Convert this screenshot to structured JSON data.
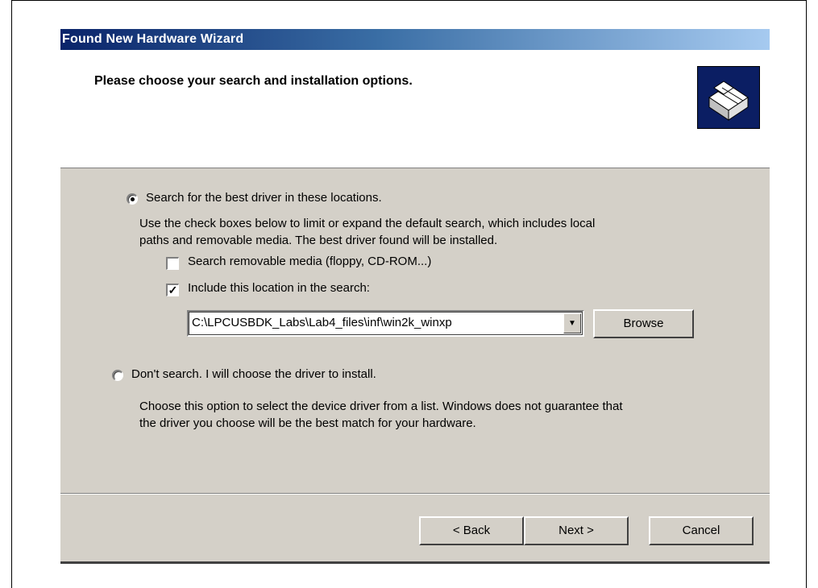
{
  "window": {
    "title": "Found New Hardware Wizard",
    "header_title": "Please choose your search and installation options."
  },
  "options": {
    "search_label": "Search for the best driver in these locations.",
    "search_selected": true,
    "search_desc_line1": "Use the check boxes below to limit or expand the default search, which includes local",
    "search_desc_line2": "paths and removable media. The best driver found will be installed.",
    "removable_label": "Search removable media (floppy, CD-ROM...)",
    "removable_checked": false,
    "include_label": "Include this location in the search:",
    "include_checked": true,
    "location_value": "C:\\LPCUSBDK_Labs\\Lab4_files\\inf\\win2k_winxp",
    "browse_label": "Browse",
    "dont_search_label": "Don't search. I will choose the driver to install.",
    "dont_search_selected": false,
    "dont_desc_line1": "Choose this option to select the device driver from a list.  Windows does not guarantee that",
    "dont_desc_line2": "the driver you choose will be the best match for your hardware."
  },
  "footer": {
    "back_label": "< Back",
    "next_label": "Next >",
    "cancel_label": "Cancel"
  },
  "icons": {
    "hardware": "hardware-box-icon",
    "dropdown": "chevron-down-icon",
    "check": "checkmark-icon"
  }
}
